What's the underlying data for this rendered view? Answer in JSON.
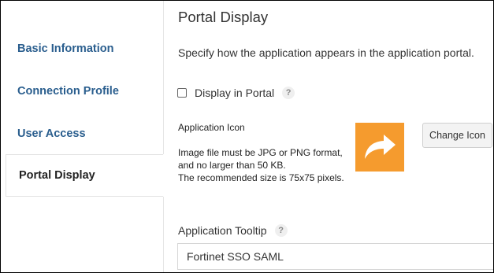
{
  "sidebar": {
    "items": [
      {
        "label": "Basic Information"
      },
      {
        "label": "Connection Profile"
      },
      {
        "label": "User Access"
      },
      {
        "label": "Portal Display"
      }
    ],
    "active_index": 3
  },
  "main": {
    "title": "Portal Display",
    "description": "Specify how the application appears in the application portal.",
    "display_in_portal": {
      "label": "Display in Portal",
      "checked": false,
      "help_icon": "question-mark"
    },
    "application_icon": {
      "label": "Application Icon",
      "help_lines": [
        "Image file must be JPG or PNG format,",
        "and no larger than 50 KB.",
        "The recommended size is 75x75 pixels."
      ],
      "icon_name": "share-arrow-icon",
      "icon_bg": "#f59b2e",
      "change_button": "Change Icon"
    },
    "application_tooltip": {
      "label": "Application Tooltip",
      "help_icon": "question-mark",
      "value": "Fortinet SSO SAML"
    }
  },
  "colors": {
    "nav_link": "#2a5e8e",
    "accent_orange": "#f59b2e"
  }
}
